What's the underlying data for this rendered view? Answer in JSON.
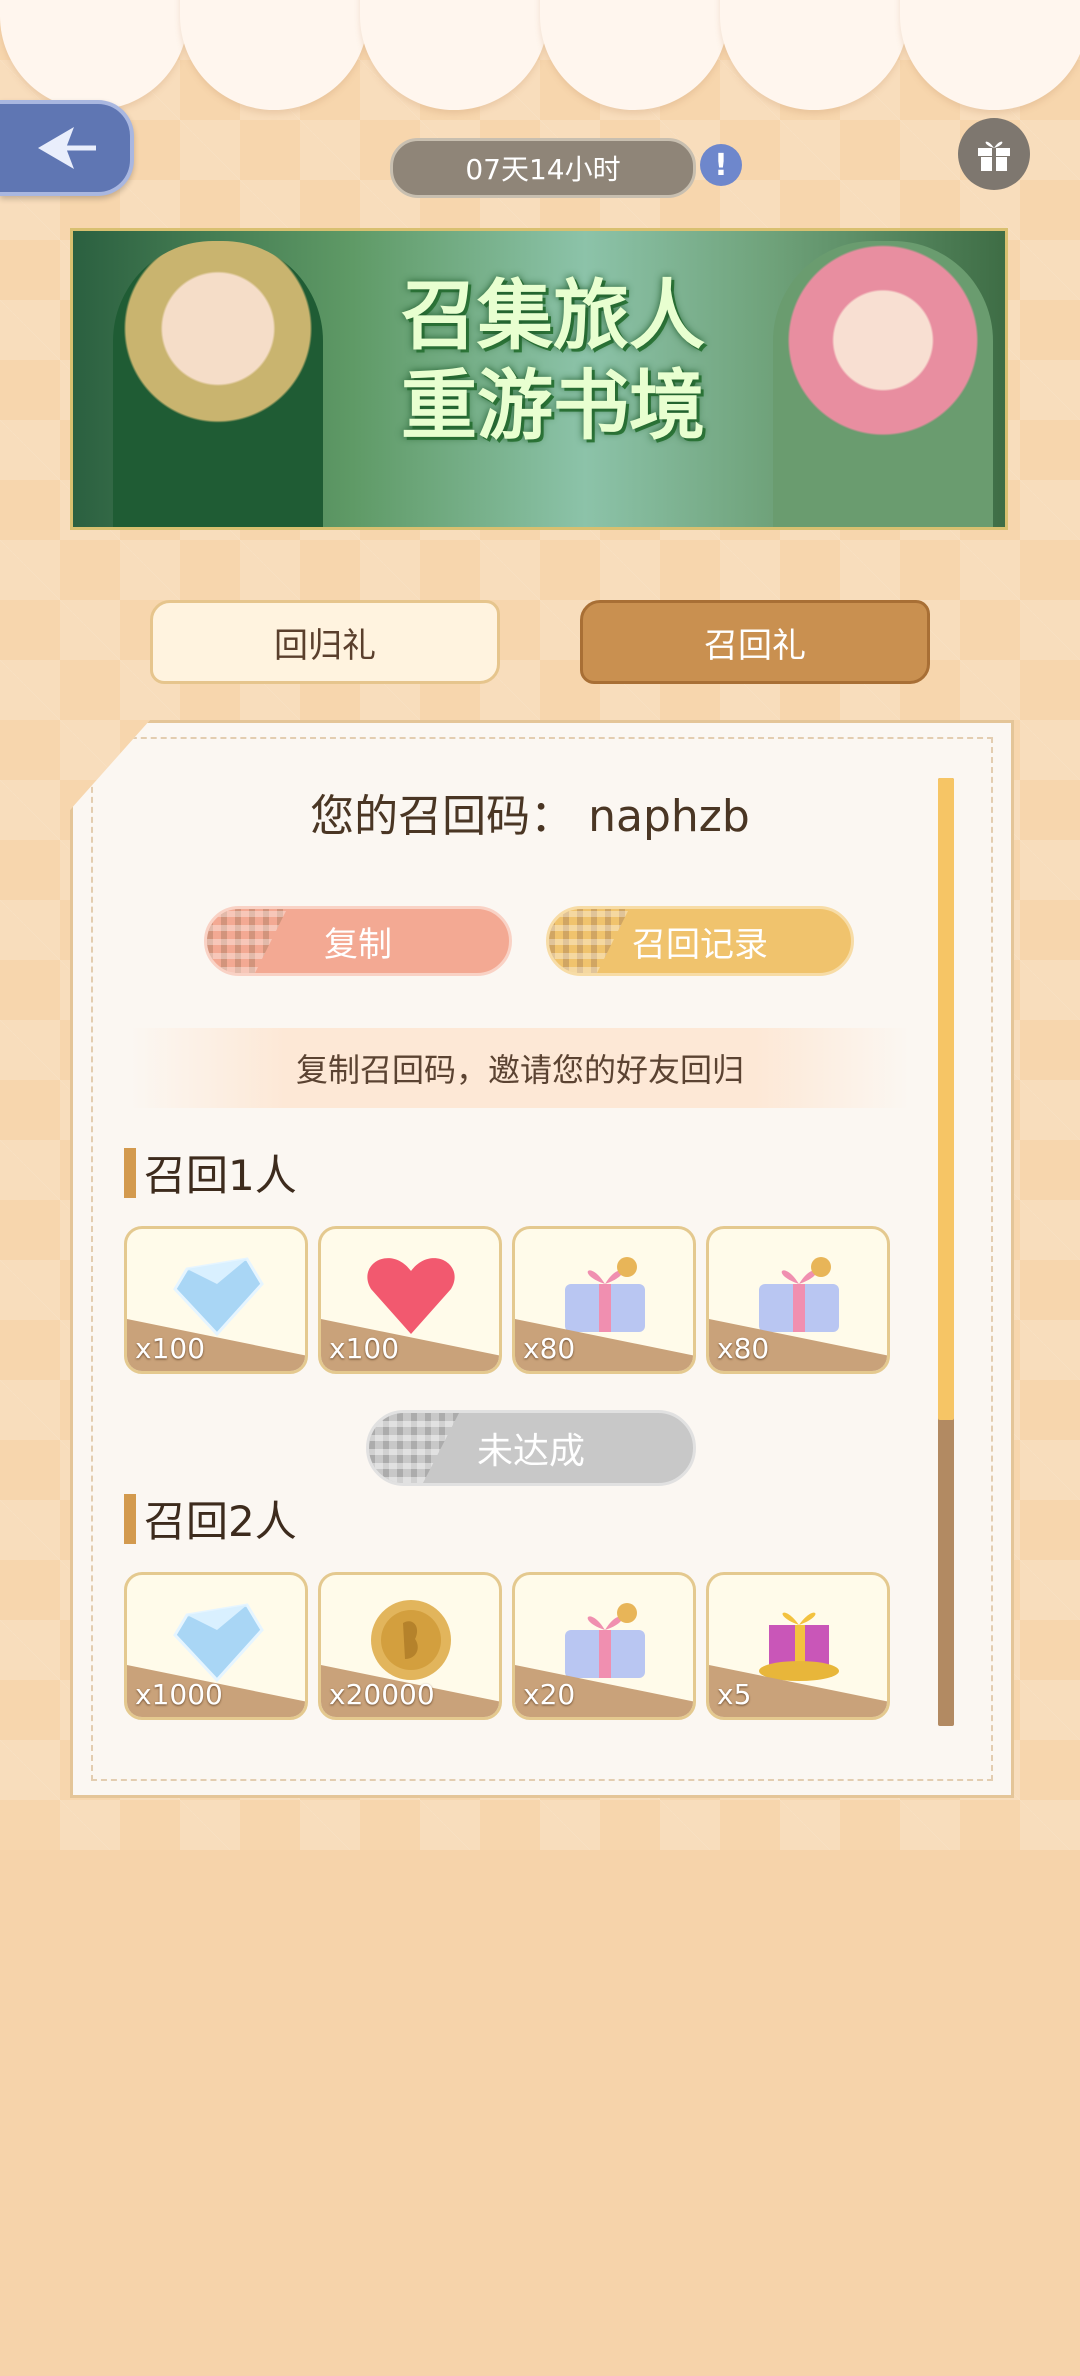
{
  "header": {
    "timer_text": "07天14小时",
    "info_icon": "exclamation",
    "back_icon": "arrow-left-icon",
    "gift_icon": "gift-icon"
  },
  "banner": {
    "title_line1": "召集旅人",
    "title_line2": "重游书境"
  },
  "tabs": [
    {
      "label": "回归礼",
      "active": false
    },
    {
      "label": "召回礼",
      "active": true
    }
  ],
  "panel": {
    "code_label": "您的召回码：",
    "code_value": "naphzb",
    "copy_label": "复制",
    "record_label": "召回记录",
    "hint": "复制召回码，邀请您的好友回归"
  },
  "sections": [
    {
      "title": "召回1人",
      "rewards": [
        {
          "icon": "diamond-icon",
          "qty": "x100"
        },
        {
          "icon": "heart-icon",
          "qty": "x100"
        },
        {
          "icon": "gift-box-icon",
          "qty": "x80"
        },
        {
          "icon": "gift-box-icon",
          "qty": "x80"
        }
      ],
      "status": "未达成"
    },
    {
      "title": "召回2人",
      "rewards": [
        {
          "icon": "diamond-icon",
          "qty": "x1000"
        },
        {
          "icon": "gold-coin-icon",
          "qty": "x20000"
        },
        {
          "icon": "gift-box-icon",
          "qty": "x20"
        },
        {
          "icon": "treasure-pile-icon",
          "qty": "x5"
        }
      ]
    }
  ],
  "colors": {
    "accent": "#c99050",
    "copy_btn": "#f3a993",
    "record_btn": "#f0c36d",
    "status_disabled": "#c8c8c8"
  }
}
